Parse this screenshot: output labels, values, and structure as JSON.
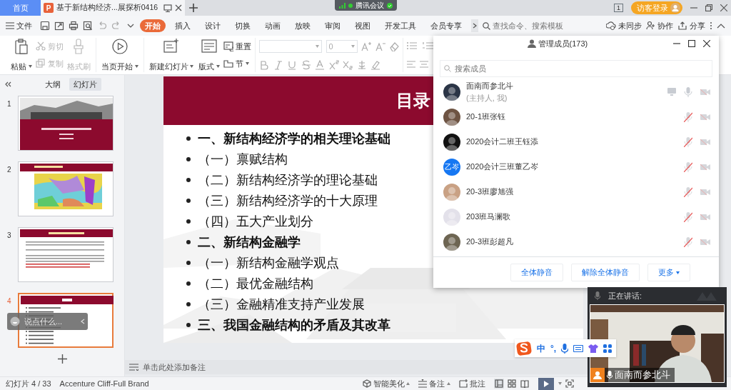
{
  "title_bar": {
    "home_tab": {
      "label": "首页",
      "selected": false
    },
    "doc_tab": {
      "icon_letter": "P",
      "title": "基于新结构经济...展探析0416",
      "selected": true
    },
    "meeting_badge": "腾讯会议",
    "page_icon_text": "1",
    "login": "访客登录"
  },
  "menu": {
    "file": "文件",
    "tabs": [
      {
        "label": "开始",
        "selected": true
      },
      {
        "label": "插入",
        "selected": false
      },
      {
        "label": "设计",
        "selected": false
      },
      {
        "label": "切换",
        "selected": false
      },
      {
        "label": "动画",
        "selected": false
      },
      {
        "label": "放映",
        "selected": false
      },
      {
        "label": "审阅",
        "selected": false
      },
      {
        "label": "视图",
        "selected": false
      },
      {
        "label": "开发工具",
        "selected": false
      },
      {
        "label": "会员专享",
        "selected": false
      }
    ],
    "search": {
      "placeholder": "查找命令、搜索模板"
    },
    "actions": [
      {
        "label": "未同步"
      },
      {
        "label": "协作"
      },
      {
        "label": "分享"
      }
    ]
  },
  "ribbon": {
    "groups": [
      [
        {
          "label": "粘贴",
          "kind": "large",
          "disabled": false,
          "dropdown": true
        },
        {
          "label": "剪切",
          "kind": "small",
          "disabled": true,
          "dropdown": false
        },
        {
          "label": "复制",
          "kind": "small",
          "disabled": true,
          "dropdown": false
        },
        {
          "label": "格式刷",
          "kind": "large",
          "disabled": true,
          "dropdown": false
        }
      ],
      [
        {
          "label": "当页开始",
          "kind": "large",
          "disabled": false,
          "dropdown": true
        }
      ],
      [
        {
          "label": "新建幻灯片",
          "kind": "large",
          "disabled": false,
          "dropdown": true
        },
        {
          "label": "版式",
          "kind": "large",
          "disabled": false,
          "dropdown": true
        },
        {
          "label": "重置",
          "kind": "small",
          "disabled": false,
          "dropdown": false
        },
        {
          "label": "节",
          "kind": "small",
          "disabled": false,
          "dropdown": true
        }
      ]
    ],
    "font_size": "0"
  },
  "left_pane": {
    "tabs": [
      {
        "label": "大纲",
        "selected": false
      },
      {
        "label": "幻灯片",
        "selected": true
      }
    ],
    "thumbnails": [
      {
        "number": "1",
        "kind": "title",
        "selected": false
      },
      {
        "number": "2",
        "kind": "map",
        "selected": false
      },
      {
        "number": "3",
        "kind": "text",
        "selected": false
      },
      {
        "number": "4",
        "kind": "toc",
        "selected": true
      }
    ]
  },
  "comment_bubble": {
    "placeholder": "说点什么..."
  },
  "slide": {
    "title": "目录",
    "items": [
      {
        "text": "一、新结构经济学的相关理论基础",
        "kind": "heading"
      },
      {
        "text": "（一）禀赋结构",
        "kind": "sub"
      },
      {
        "text": "（二）新结构经济学的理论基础",
        "kind": "sub"
      },
      {
        "text": "（三）新结构经济学的十大原理",
        "kind": "sub"
      },
      {
        "text": "（四）五大产业划分",
        "kind": "sub"
      },
      {
        "text": "二、新结构金融学",
        "kind": "heading"
      },
      {
        "text": "（一）新结构金融学观点",
        "kind": "sub"
      },
      {
        "text": "（二）最优金融结构",
        "kind": "sub"
      },
      {
        "text": "（三）金融精准支持产业发展",
        "kind": "sub"
      },
      {
        "text": "三、我国金融结构的矛盾及其改革",
        "kind": "heading"
      }
    ]
  },
  "notes": {
    "placeholder": "单击此处添加备注"
  },
  "status_bar": {
    "slide_info": "幻灯片 4 / 33",
    "theme": "Accenture Cliff-Full Brand",
    "beautify": "智能美化",
    "notes": "备注",
    "comment": "批注"
  },
  "members_panel": {
    "title": "管理成员(173)",
    "search": {
      "placeholder": "搜索成员"
    },
    "members": [
      {
        "name": "面南而参北斗",
        "role": "(主持人, 我)",
        "color": "#2b3546",
        "sharing": true,
        "mic_muted": false
      },
      {
        "name": "20-1班张钰",
        "color": "#6e5443",
        "sharing": false,
        "mic_muted": true
      },
      {
        "name": "2020会计二班王钰添",
        "color": "#111111",
        "sharing": false,
        "mic_muted": true
      },
      {
        "name": "2020会计三班董乙岑",
        "color": "#1677f2",
        "avatar_text": "乙岑",
        "sharing": false,
        "mic_muted": true
      },
      {
        "name": "20-3班廖旭强",
        "color": "#c9a184",
        "sharing": false,
        "mic_muted": true
      },
      {
        "name": "203班马澜歌",
        "color": "#e3e1ea",
        "sharing": false,
        "mic_muted": true
      },
      {
        "name": "20-3班彭超凡",
        "color": "#6d6552",
        "sharing": false,
        "mic_muted": true
      }
    ],
    "buttons": [
      "全体静音",
      "解除全体静音"
    ],
    "more": "更多"
  },
  "video": {
    "speaking_label": "正在讲话:",
    "speaker": "面南而参北斗"
  },
  "ime": {
    "mode": "中",
    "punct": "°,"
  }
}
